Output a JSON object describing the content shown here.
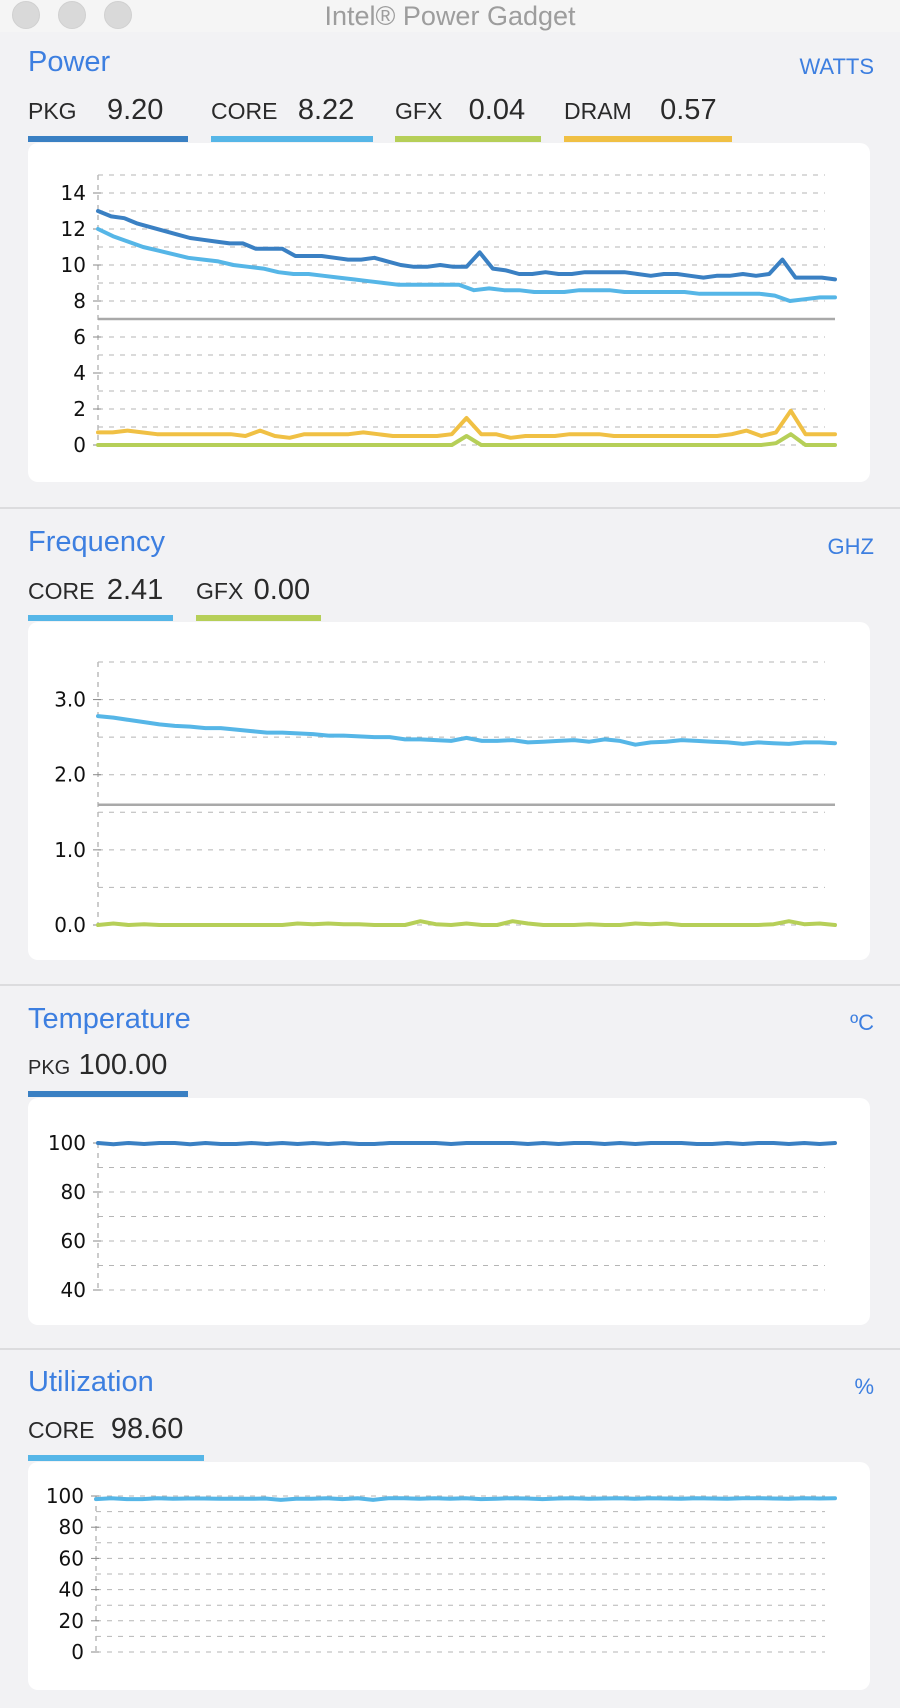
{
  "window": {
    "title": "Intel® Power Gadget"
  },
  "colors": {
    "accent": "#3d7fe0",
    "pkg": "#3a80c3",
    "core": "#56b6e7",
    "gfx": "#b6cf58",
    "dram": "#f0c044",
    "limit": "#a9a9a9"
  },
  "sections": {
    "power": {
      "title": "Power",
      "unit": "WATTS",
      "metrics": [
        {
          "label": "PKG",
          "value": "9.20"
        },
        {
          "label": "CORE",
          "value": "8.22"
        },
        {
          "label": "GFX",
          "value": "0.04"
        },
        {
          "label": "DRAM",
          "value": "0.57"
        }
      ]
    },
    "frequency": {
      "title": "Frequency",
      "unit": "GHZ",
      "metrics": [
        {
          "label": "CORE",
          "value": "2.41"
        },
        {
          "label": "GFX",
          "value": "0.00"
        }
      ]
    },
    "temperature": {
      "title": "Temperature",
      "unit": "ºC",
      "metrics": [
        {
          "label": "PKG",
          "value": "100.00"
        }
      ]
    },
    "utilization": {
      "title": "Utilization",
      "unit": "%",
      "metrics": [
        {
          "label": "CORE",
          "value": "98.60"
        }
      ]
    }
  },
  "chart_data": [
    {
      "type": "line",
      "title": "Power",
      "ylabel": "WATTS",
      "ylim": [
        0,
        15
      ],
      "yticks": [
        0,
        2,
        4,
        6,
        8,
        10,
        12,
        14
      ],
      "ytick_labels": [
        "0",
        "2",
        "4",
        "6",
        "8",
        "10",
        "12",
        "14"
      ],
      "grid": true,
      "reference_line": 7,
      "series": [
        {
          "name": "PKG",
          "color": "#3a80c3",
          "values": [
            13.0,
            12.7,
            12.6,
            12.3,
            12.1,
            11.9,
            11.7,
            11.5,
            11.4,
            11.3,
            11.2,
            11.2,
            10.9,
            10.9,
            10.9,
            10.5,
            10.5,
            10.5,
            10.4,
            10.3,
            10.3,
            10.4,
            10.2,
            10.0,
            9.9,
            9.9,
            10.0,
            9.9,
            9.9,
            10.7,
            9.8,
            9.7,
            9.5,
            9.5,
            9.6,
            9.5,
            9.5,
            9.6,
            9.6,
            9.6,
            9.6,
            9.5,
            9.4,
            9.5,
            9.5,
            9.4,
            9.3,
            9.4,
            9.4,
            9.5,
            9.4,
            9.5,
            10.3,
            9.3,
            9.3,
            9.3,
            9.2
          ]
        },
        {
          "name": "CORE",
          "color": "#56b6e7",
          "values": [
            12.0,
            11.6,
            11.3,
            11.0,
            10.8,
            10.6,
            10.4,
            10.3,
            10.2,
            10.0,
            9.9,
            9.8,
            9.6,
            9.5,
            9.5,
            9.4,
            9.3,
            9.2,
            9.1,
            9.0,
            8.9,
            8.9,
            8.9,
            8.9,
            8.9,
            8.6,
            8.7,
            8.6,
            8.6,
            8.5,
            8.5,
            8.5,
            8.6,
            8.6,
            8.6,
            8.5,
            8.5,
            8.5,
            8.5,
            8.5,
            8.4,
            8.4,
            8.4,
            8.4,
            8.4,
            8.3,
            8.0,
            8.1,
            8.2,
            8.2
          ]
        },
        {
          "name": "GFX",
          "color": "#b6cf58",
          "values": [
            0,
            0,
            0,
            0,
            0,
            0,
            0,
            0,
            0,
            0,
            0,
            0,
            0,
            0,
            0,
            0,
            0,
            0,
            0,
            0,
            0,
            0,
            0,
            0,
            0.0,
            0.5,
            0.0,
            0,
            0,
            0,
            0,
            0,
            0,
            0,
            0,
            0,
            0,
            0,
            0,
            0,
            0,
            0,
            0,
            0,
            0,
            0,
            0.1,
            0.6,
            0.0,
            0,
            0
          ]
        },
        {
          "name": "DRAM",
          "color": "#f0c044",
          "values": [
            0.7,
            0.7,
            0.8,
            0.7,
            0.6,
            0.6,
            0.6,
            0.6,
            0.6,
            0.6,
            0.5,
            0.8,
            0.5,
            0.4,
            0.6,
            0.6,
            0.6,
            0.6,
            0.7,
            0.6,
            0.5,
            0.5,
            0.5,
            0.5,
            0.6,
            1.5,
            0.6,
            0.6,
            0.4,
            0.5,
            0.5,
            0.5,
            0.6,
            0.6,
            0.6,
            0.5,
            0.5,
            0.5,
            0.5,
            0.5,
            0.5,
            0.5,
            0.5,
            0.6,
            0.8,
            0.5,
            0.7,
            1.9,
            0.6,
            0.6,
            0.6
          ]
        }
      ]
    },
    {
      "type": "line",
      "title": "Frequency",
      "ylabel": "GHZ",
      "ylim": [
        0,
        3.5
      ],
      "yticks": [
        0,
        1,
        2,
        3
      ],
      "ytick_labels": [
        "0.0",
        "1.0",
        "2.0",
        "3.0"
      ],
      "grid": true,
      "reference_line": 1.6,
      "series": [
        {
          "name": "CORE",
          "color": "#56b6e7",
          "values": [
            2.78,
            2.76,
            2.73,
            2.7,
            2.67,
            2.65,
            2.64,
            2.62,
            2.62,
            2.6,
            2.58,
            2.56,
            2.56,
            2.55,
            2.54,
            2.52,
            2.52,
            2.51,
            2.5,
            2.5,
            2.47,
            2.47,
            2.46,
            2.45,
            2.49,
            2.45,
            2.45,
            2.46,
            2.43,
            2.44,
            2.45,
            2.46,
            2.44,
            2.47,
            2.45,
            2.4,
            2.43,
            2.44,
            2.46,
            2.45,
            2.44,
            2.43,
            2.41,
            2.43,
            2.42,
            2.41,
            2.43,
            2.43,
            2.42
          ]
        },
        {
          "name": "GFX",
          "color": "#b6cf58",
          "values": [
            0.0,
            0.02,
            0.0,
            0.01,
            0,
            0,
            0,
            0,
            0,
            0,
            0,
            0,
            0,
            0.02,
            0.01,
            0.02,
            0.01,
            0.01,
            0,
            0,
            0,
            0.05,
            0.01,
            0,
            0.02,
            0.0,
            0.0,
            0.05,
            0.02,
            0,
            0,
            0,
            0.01,
            0,
            0,
            0.02,
            0.01,
            0.02,
            0,
            0,
            0,
            0,
            0,
            0,
            0.01,
            0.05,
            0.01,
            0.02,
            0
          ]
        }
      ]
    },
    {
      "type": "line",
      "title": "Temperature",
      "ylabel": "ºC",
      "ylim": [
        40,
        100
      ],
      "yticks": [
        40,
        60,
        80,
        100
      ],
      "ytick_labels": [
        "40",
        "60",
        "80",
        "100"
      ],
      "grid": true,
      "series": [
        {
          "name": "PKG",
          "color": "#3a80c3",
          "values": [
            100,
            99.5,
            100,
            99.6,
            100,
            100,
            99.5,
            100,
            99.6,
            99.6,
            100,
            99.6,
            100,
            99.6,
            100,
            99.6,
            100,
            99.6,
            99.6,
            100,
            100,
            100,
            100,
            99.6,
            100,
            100,
            100,
            100,
            99.6,
            100,
            99.6,
            100,
            100,
            99.6,
            100,
            99.6,
            100,
            100,
            100,
            99.6,
            99.6,
            100,
            99.6,
            100,
            100,
            99.6,
            100,
            99.6,
            100
          ]
        }
      ]
    },
    {
      "type": "line",
      "title": "Utilization",
      "ylabel": "%",
      "ylim": [
        0,
        100
      ],
      "yticks": [
        0,
        20,
        40,
        60,
        80,
        100
      ],
      "ytick_labels": [
        "0",
        "20",
        "40",
        "60",
        "80",
        "100"
      ],
      "grid": true,
      "series": [
        {
          "name": "CORE",
          "color": "#56b6e7",
          "values": [
            98,
            98.5,
            98,
            98,
            98.6,
            98.2,
            98.4,
            98.4,
            98.2,
            98.2,
            98.2,
            98.4,
            97.5,
            98.2,
            98.2,
            98.6,
            98,
            98.6,
            97.5,
            98.6,
            98.6,
            98.2,
            98.6,
            98.3,
            98.6,
            98,
            98.2,
            98.6,
            98.4,
            98,
            98.4,
            98.6,
            98.2,
            98.4,
            98.5,
            98.3,
            98.6,
            98.4,
            98.2,
            98.6,
            98.4,
            98.3,
            98.6,
            98.6,
            98.4,
            98.2,
            98.5,
            98.4,
            98.6
          ]
        }
      ]
    }
  ]
}
